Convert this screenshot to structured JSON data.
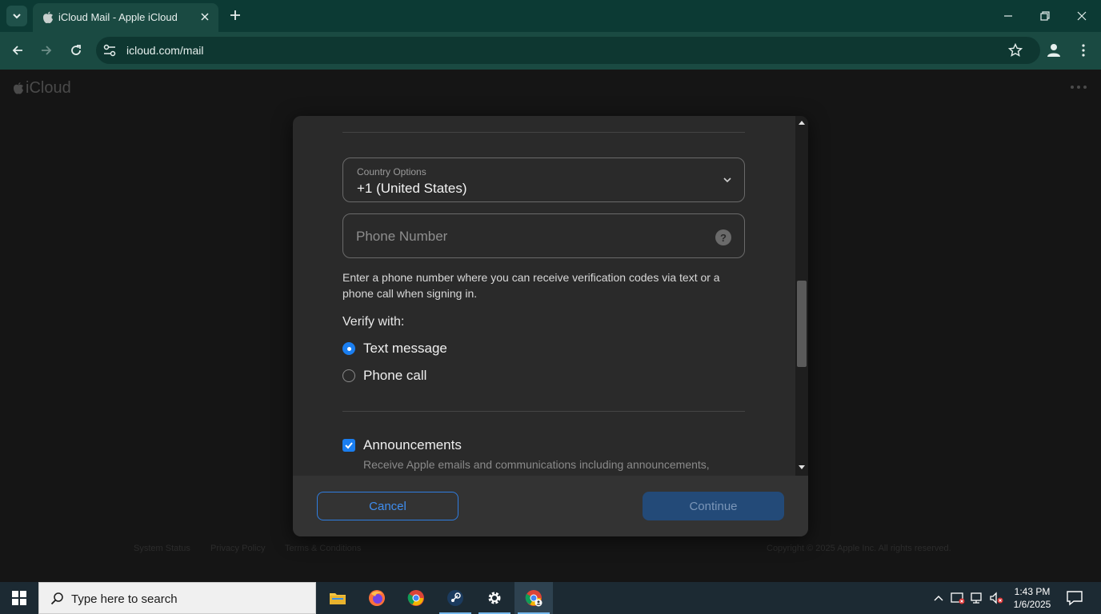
{
  "browser": {
    "tab_title": "iCloud Mail - Apple iCloud",
    "url": "icloud.com/mail"
  },
  "page": {
    "logo_text": "iCloud",
    "footer": {
      "system_status": "System Status",
      "privacy_policy": "Privacy Policy",
      "terms": "Terms & Conditions",
      "copyright": "Copyright © 2025 Apple Inc. All rights reserved."
    }
  },
  "dialog": {
    "country": {
      "label": "Country Options",
      "value": "+1 (United States)"
    },
    "phone": {
      "placeholder": "Phone Number",
      "help": "?"
    },
    "helper_text": "Enter a phone number where you can receive verification codes via text or a phone call when signing in.",
    "verify_label": "Verify with:",
    "verify_options": [
      {
        "label": "Text message",
        "selected": true
      },
      {
        "label": "Phone call",
        "selected": false
      }
    ],
    "announcements": {
      "label": "Announcements",
      "checked": true,
      "description": "Receive Apple emails and communications including announcements, marketing recommendations, and the latest about Apple products, services, and software."
    },
    "buttons": {
      "cancel": "Cancel",
      "continue": "Continue"
    }
  },
  "taskbar": {
    "search_placeholder": "Type here to search",
    "time": "1:43 PM",
    "date": "1/6/2025",
    "apps": [
      "file-explorer",
      "firefox",
      "chrome",
      "steam",
      "settings",
      "chrome-profile"
    ]
  },
  "colors": {
    "browser_tabbar": "#0c3a34",
    "browser_toolbar": "#1a4a42",
    "accent_blue": "#1a7ef0",
    "dialog_bg": "#2a2a2a",
    "continue_disabled": "#234a78"
  }
}
